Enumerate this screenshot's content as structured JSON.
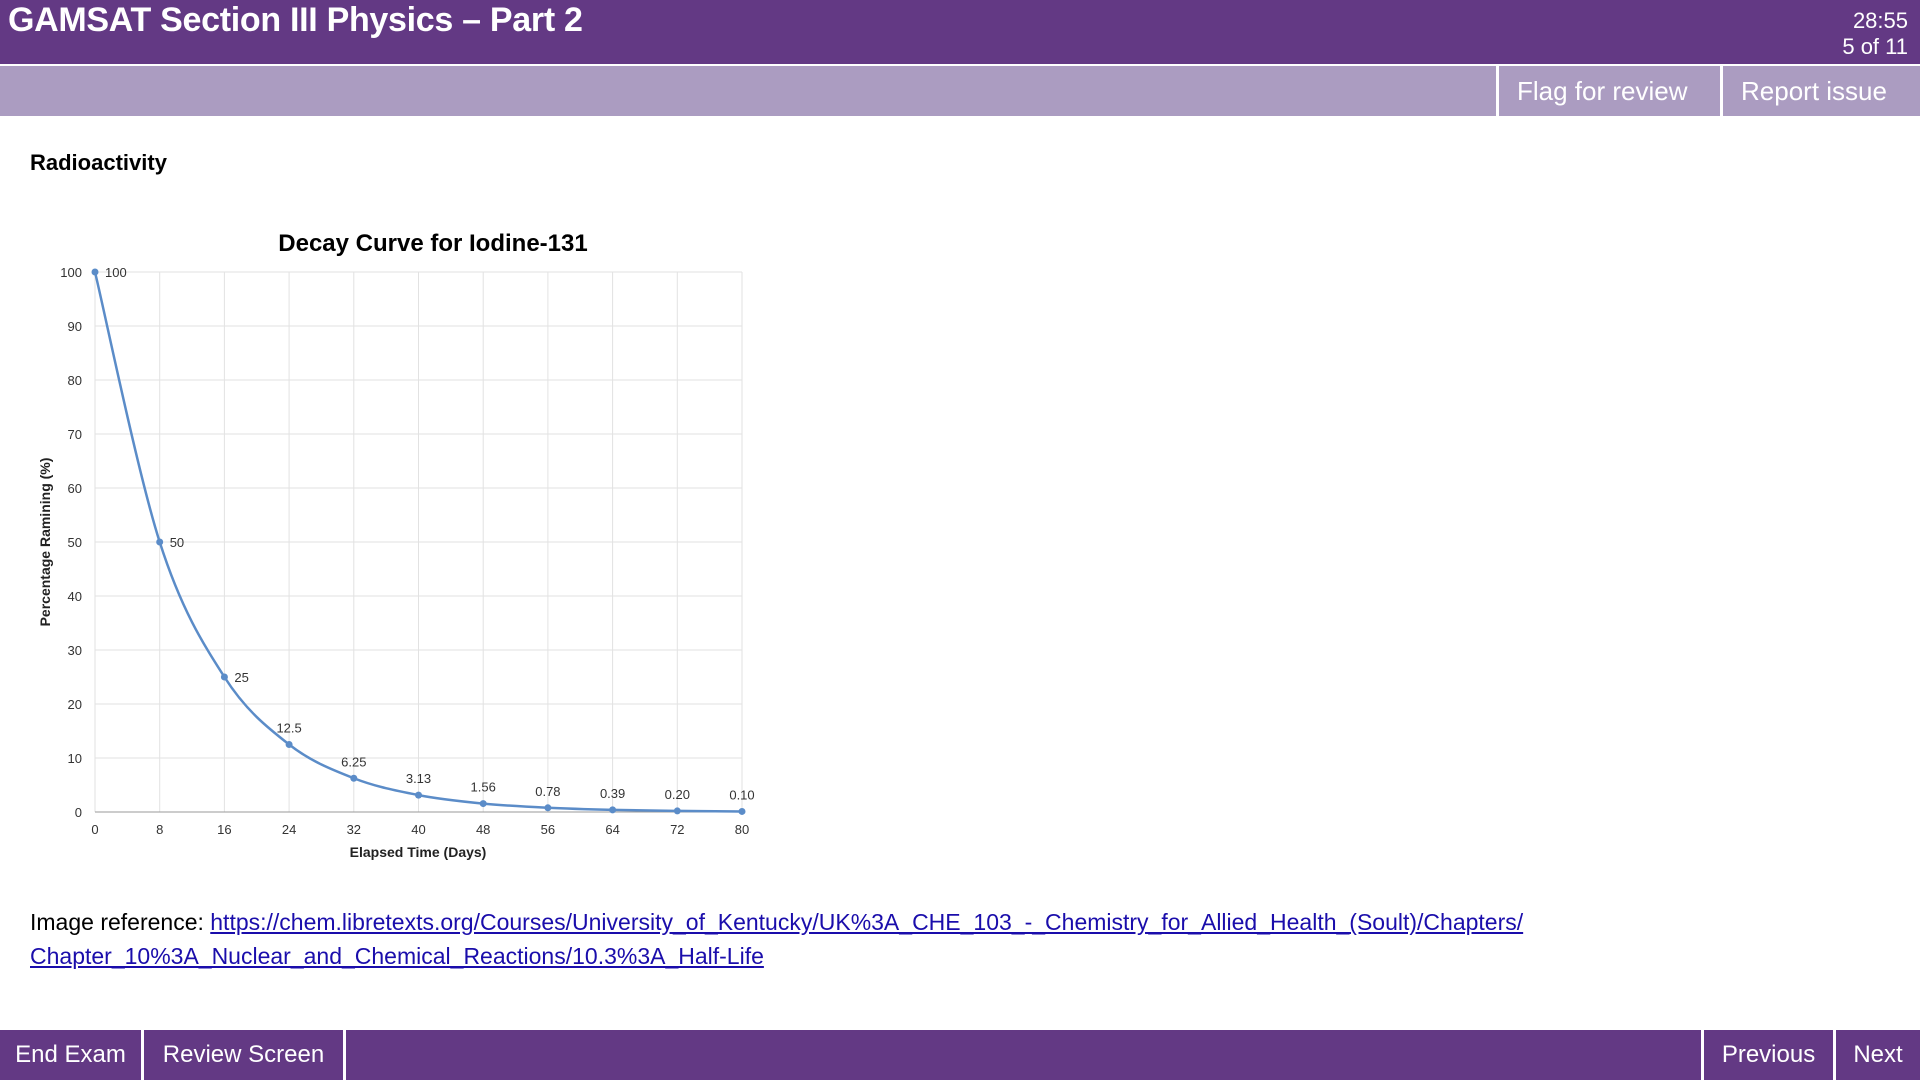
{
  "header": {
    "title": "GAMSAT Section III Physics – Part 2",
    "timer": "28:55",
    "progress": "5 of 11"
  },
  "toolbar": {
    "flag_label": "Flag for review",
    "report_label": "Report issue"
  },
  "question": {
    "heading": "Radioactivity",
    "reference_prefix": "Image reference: ",
    "reference_link": "https://chem.libretexts.org/Courses/University_of_Kentucky/UK%3A_CHE_103_-_Chemistry_for_Allied_Health_(Soult)/Chapters/Chapter_10%3A_Nuclear_and_Chemical_Reactions/10.3%3A_Half-Life"
  },
  "footer": {
    "end_label": "End Exam",
    "review_label": "Review Screen",
    "previous_label": "Previous",
    "next_label": "Next"
  },
  "colors": {
    "brand": "#633984",
    "toolbar": "#ab9cc1",
    "series": "#5b8cc8"
  },
  "chart_data": {
    "type": "line",
    "title": "Decay Curve for Iodine-131",
    "xlabel": "Elapsed Time (Days)",
    "ylabel": "Percentage Ramining (%)",
    "x": [
      0,
      8,
      16,
      24,
      32,
      40,
      48,
      56,
      64,
      72,
      80
    ],
    "y": [
      100,
      50,
      25,
      12.5,
      6.25,
      3.13,
      1.56,
      0.78,
      0.39,
      0.2,
      0.1
    ],
    "labels": [
      "100",
      "50",
      "25",
      "12.5",
      "6.25",
      "3.13",
      "1.56",
      "0.78",
      "0.39",
      "0.20",
      "0.10"
    ],
    "xticks": [
      "0",
      "8",
      "16",
      "24",
      "32",
      "40",
      "48",
      "56",
      "64",
      "72",
      "80"
    ],
    "yticks": [
      "0",
      "10",
      "20",
      "30",
      "40",
      "50",
      "60",
      "70",
      "80",
      "90",
      "100"
    ],
    "xlim": [
      0,
      80
    ],
    "ylim": [
      0,
      100
    ],
    "grid": true
  }
}
